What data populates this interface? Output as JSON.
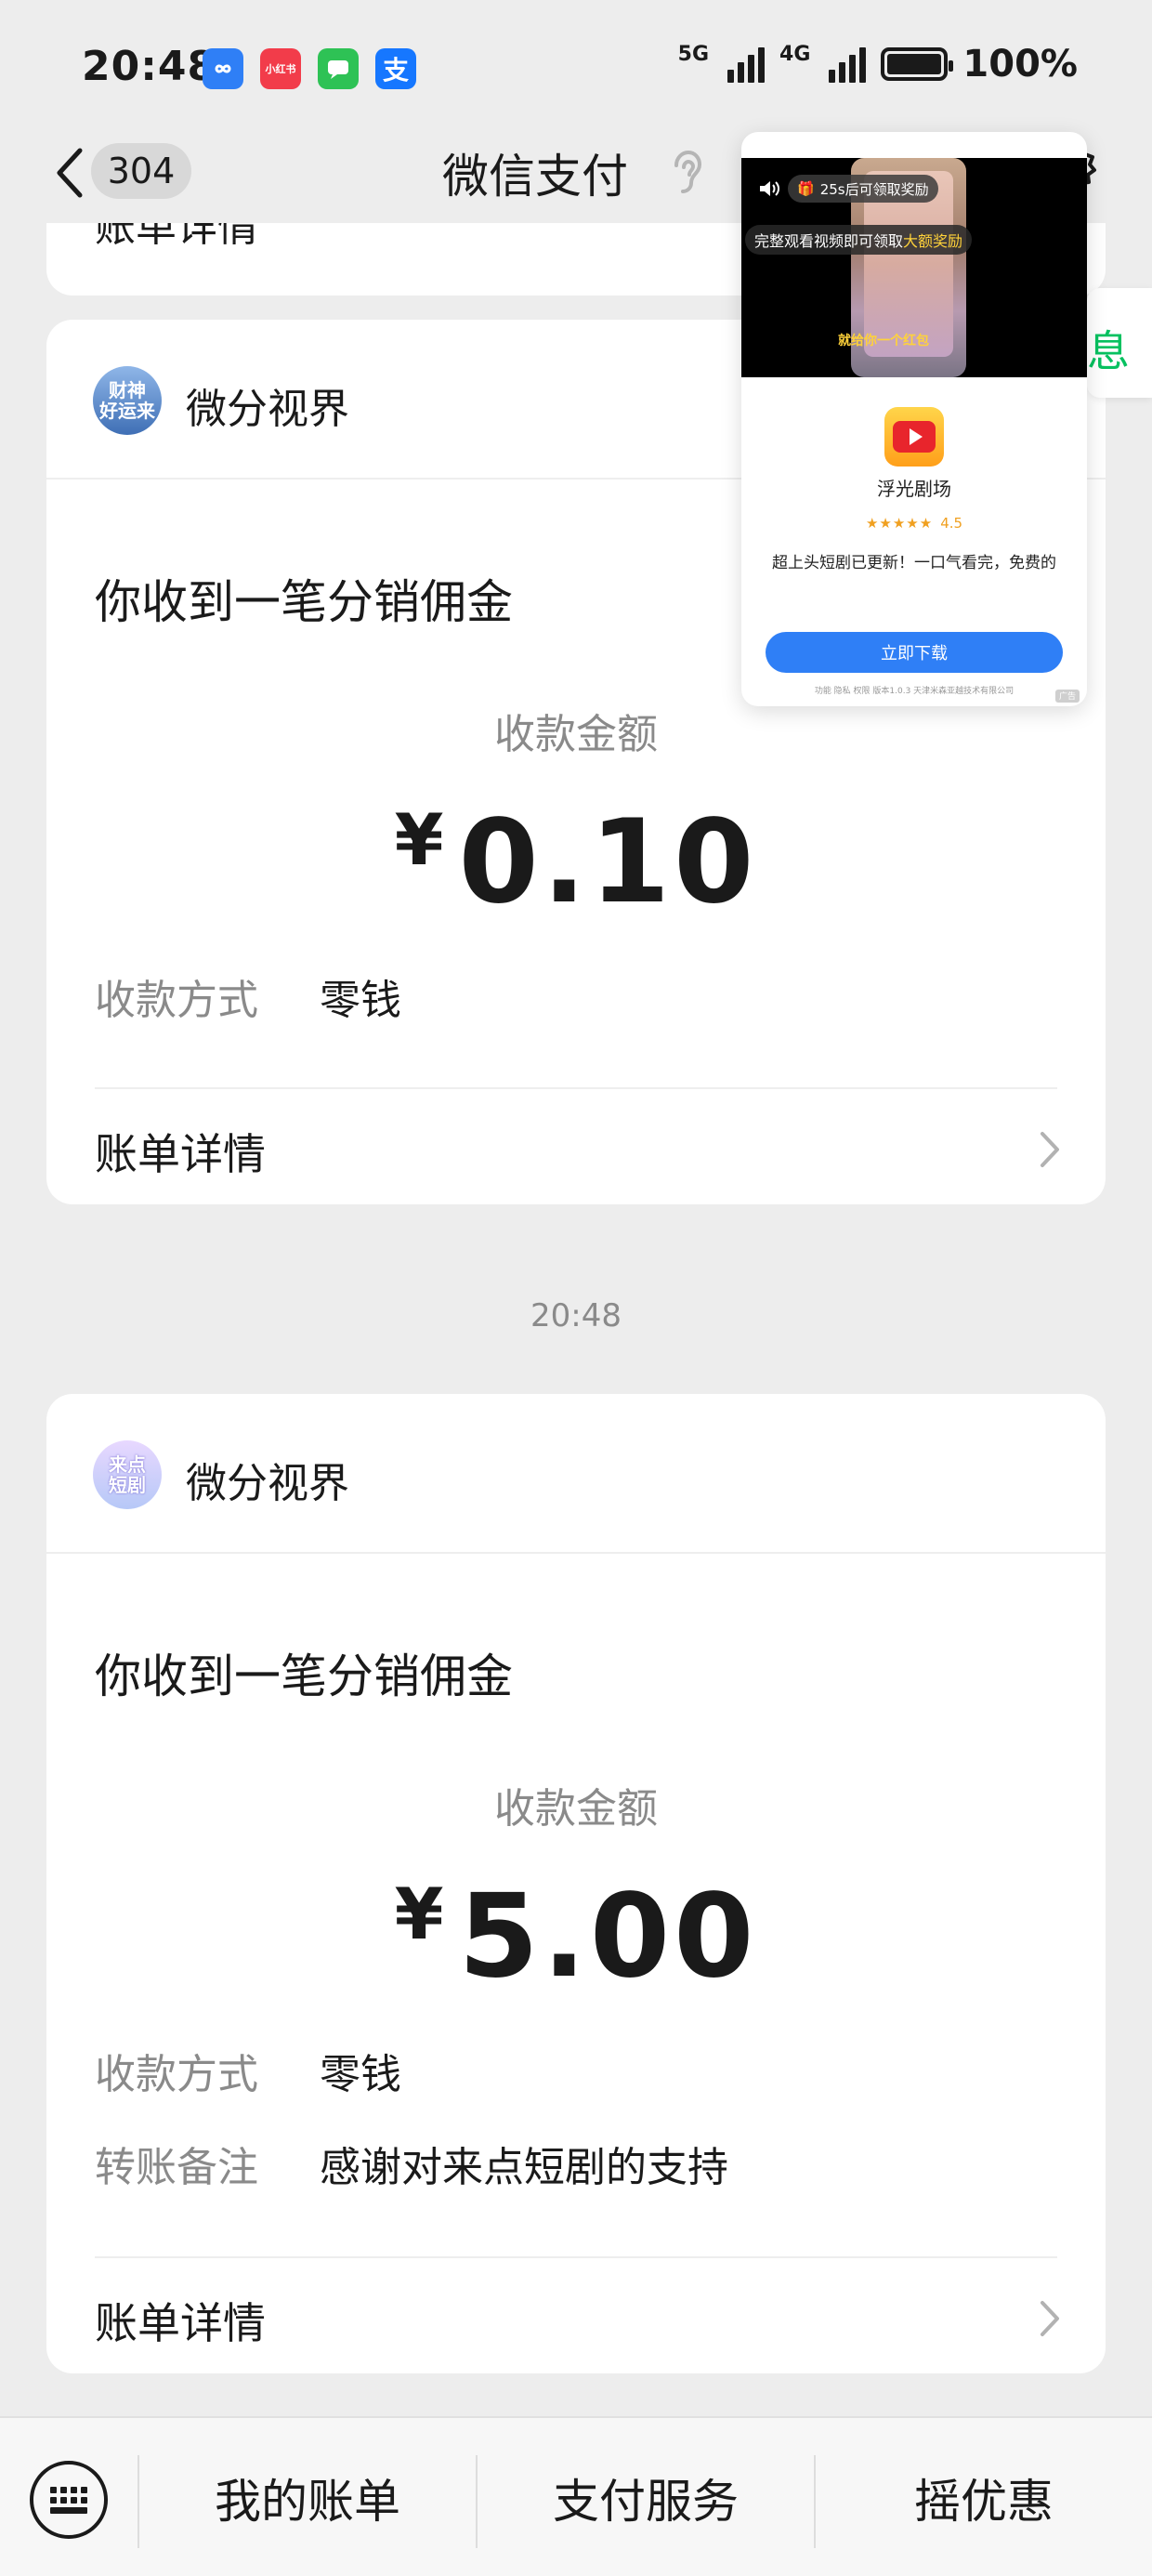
{
  "status_bar": {
    "time": "20:48",
    "app_icons": [
      "infinity-app-icon",
      "xiaohongshu-icon",
      "messages-icon",
      "alipay-icon"
    ],
    "xiaohongshu_label": "小红书",
    "alipay_label": "支",
    "net1": "5G",
    "net2": "4G",
    "battery": "100%"
  },
  "nav": {
    "unread_count": "304",
    "title": "微信支付"
  },
  "remnant": {
    "label": "账单详情"
  },
  "cards": [
    {
      "sender": "微分视界",
      "avatar_text": "财神\n好运来",
      "title": "你收到一笔分销佣金",
      "amount_label": "收款金额",
      "currency": "¥",
      "amount": "0.10",
      "method_label": "收款方式",
      "method_value": "零钱",
      "bill_link": "账单详情"
    },
    {
      "sender": "微分视界",
      "avatar_text": "来点\n短剧",
      "title": "你收到一笔分销佣金",
      "amount_label": "收款金额",
      "currency": "¥",
      "amount": "5.00",
      "method_label": "收款方式",
      "method_value": "零钱",
      "note_label": "转账备注",
      "note_value": "感谢对来点短剧的支持",
      "bill_link": "账单详情"
    }
  ],
  "time_separator": "20:48",
  "bottom_bar": {
    "tabs": [
      "我的账单",
      "支付服务",
      "摇优惠"
    ]
  },
  "ad": {
    "countdown": "25s后可领取奖励",
    "banner_prefix": "完整观看视频即可领取",
    "banner_highlight": "大额奖励",
    "video_caption": "就给你一个红包",
    "app_name": "浮光剧场",
    "rating": "4.5",
    "description": "超上头短剧已更新！一口气看完，免费的",
    "download_button": "立即下载",
    "footer": "功能  隐私  权限  版本1.0.3  天津米森亚越技术有限公司",
    "tag": "广告"
  },
  "right_peek_text": "息",
  "colors": {
    "background": "#ededed",
    "card": "#ffffff",
    "accent_green": "#07c160",
    "download_blue": "#2f7ff6",
    "muted_text": "#8a8a8a"
  }
}
